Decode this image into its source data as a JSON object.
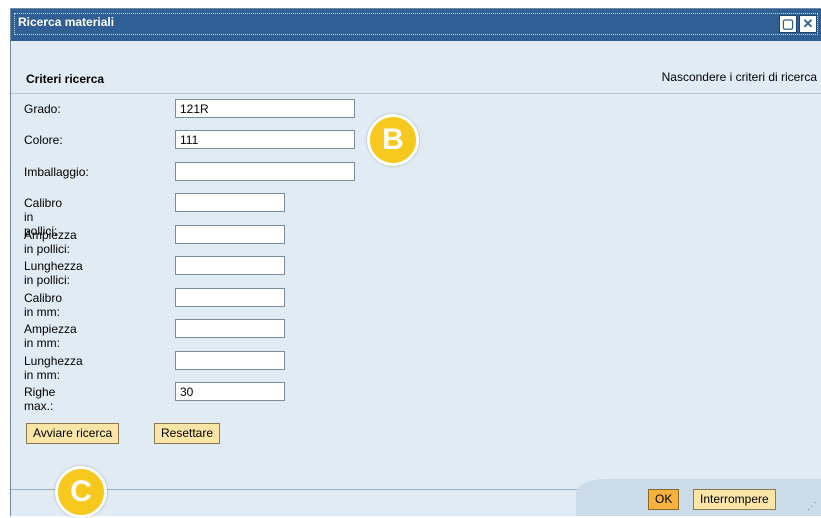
{
  "window": {
    "title": "Ricerca materiali"
  },
  "header": {
    "title": "Criteri ricerca",
    "toggle_link": "Nascondere i criteri di ricerca"
  },
  "fields": [
    {
      "label": "Grado:",
      "value": "121R"
    },
    {
      "label": "Colore:",
      "value": "111"
    },
    {
      "label": "Imballaggio:",
      "value": ""
    },
    {
      "label": "Calibro in pollici:",
      "value": ""
    },
    {
      "label": "Ampiezza in pollici:",
      "value": ""
    },
    {
      "label": "Lunghezza in pollici:",
      "value": ""
    },
    {
      "label": "Calibro in mm:",
      "value": ""
    },
    {
      "label": "Ampiezza in mm:",
      "value": ""
    },
    {
      "label": "Lunghezza in mm:",
      "value": ""
    },
    {
      "label": "Righe max.:",
      "value": "30"
    }
  ],
  "actions": {
    "search_label": "Avviare ricerca",
    "reset_label": "Resettare"
  },
  "footer": {
    "ok_label": "OK",
    "cancel_label": "Interrompere"
  },
  "badges": {
    "b": "B",
    "c": "C"
  },
  "colors": {
    "titlebar": "#2f5f94",
    "dialog_bg": "#e1ebf3",
    "button": "#fbe6a8",
    "ok_button": "#f5b33e",
    "badge": "#f7c81d"
  }
}
